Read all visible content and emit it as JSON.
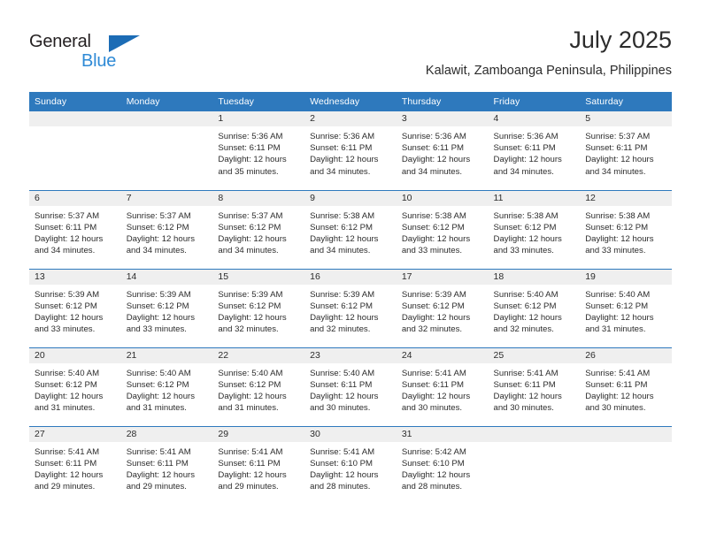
{
  "brand": {
    "name_part1": "General",
    "name_part2": "Blue",
    "triangle_color": "#1c6cb5",
    "blue_color": "#2e8ad6",
    "dark_color": "#231f20"
  },
  "header": {
    "title": "July 2025",
    "subtitle": "Kalawit, Zamboanga Peninsula, Philippines"
  },
  "theme": {
    "header_row_bg": "#2e79bd",
    "daynum_band_bg": "#efefef",
    "cell_bg": "#ffffff",
    "text_color": "#2c2c2c"
  },
  "weekdays": [
    "Sunday",
    "Monday",
    "Tuesday",
    "Wednesday",
    "Thursday",
    "Friday",
    "Saturday"
  ],
  "labels": {
    "sunrise_prefix": "Sunrise:",
    "sunset_prefix": "Sunset:",
    "daylight_prefix": "Daylight:"
  },
  "weeks": [
    [
      {
        "day": "",
        "empty": true
      },
      {
        "day": "",
        "empty": true
      },
      {
        "day": "1",
        "sunrise": "Sunrise: 5:36 AM",
        "sunset": "Sunset: 6:11 PM",
        "daylight_l1": "Daylight: 12 hours",
        "daylight_l2": "and 35 minutes."
      },
      {
        "day": "2",
        "sunrise": "Sunrise: 5:36 AM",
        "sunset": "Sunset: 6:11 PM",
        "daylight_l1": "Daylight: 12 hours",
        "daylight_l2": "and 34 minutes."
      },
      {
        "day": "3",
        "sunrise": "Sunrise: 5:36 AM",
        "sunset": "Sunset: 6:11 PM",
        "daylight_l1": "Daylight: 12 hours",
        "daylight_l2": "and 34 minutes."
      },
      {
        "day": "4",
        "sunrise": "Sunrise: 5:36 AM",
        "sunset": "Sunset: 6:11 PM",
        "daylight_l1": "Daylight: 12 hours",
        "daylight_l2": "and 34 minutes."
      },
      {
        "day": "5",
        "sunrise": "Sunrise: 5:37 AM",
        "sunset": "Sunset: 6:11 PM",
        "daylight_l1": "Daylight: 12 hours",
        "daylight_l2": "and 34 minutes."
      }
    ],
    [
      {
        "day": "6",
        "sunrise": "Sunrise: 5:37 AM",
        "sunset": "Sunset: 6:11 PM",
        "daylight_l1": "Daylight: 12 hours",
        "daylight_l2": "and 34 minutes."
      },
      {
        "day": "7",
        "sunrise": "Sunrise: 5:37 AM",
        "sunset": "Sunset: 6:12 PM",
        "daylight_l1": "Daylight: 12 hours",
        "daylight_l2": "and 34 minutes."
      },
      {
        "day": "8",
        "sunrise": "Sunrise: 5:37 AM",
        "sunset": "Sunset: 6:12 PM",
        "daylight_l1": "Daylight: 12 hours",
        "daylight_l2": "and 34 minutes."
      },
      {
        "day": "9",
        "sunrise": "Sunrise: 5:38 AM",
        "sunset": "Sunset: 6:12 PM",
        "daylight_l1": "Daylight: 12 hours",
        "daylight_l2": "and 34 minutes."
      },
      {
        "day": "10",
        "sunrise": "Sunrise: 5:38 AM",
        "sunset": "Sunset: 6:12 PM",
        "daylight_l1": "Daylight: 12 hours",
        "daylight_l2": "and 33 minutes."
      },
      {
        "day": "11",
        "sunrise": "Sunrise: 5:38 AM",
        "sunset": "Sunset: 6:12 PM",
        "daylight_l1": "Daylight: 12 hours",
        "daylight_l2": "and 33 minutes."
      },
      {
        "day": "12",
        "sunrise": "Sunrise: 5:38 AM",
        "sunset": "Sunset: 6:12 PM",
        "daylight_l1": "Daylight: 12 hours",
        "daylight_l2": "and 33 minutes."
      }
    ],
    [
      {
        "day": "13",
        "sunrise": "Sunrise: 5:39 AM",
        "sunset": "Sunset: 6:12 PM",
        "daylight_l1": "Daylight: 12 hours",
        "daylight_l2": "and 33 minutes."
      },
      {
        "day": "14",
        "sunrise": "Sunrise: 5:39 AM",
        "sunset": "Sunset: 6:12 PM",
        "daylight_l1": "Daylight: 12 hours",
        "daylight_l2": "and 33 minutes."
      },
      {
        "day": "15",
        "sunrise": "Sunrise: 5:39 AM",
        "sunset": "Sunset: 6:12 PM",
        "daylight_l1": "Daylight: 12 hours",
        "daylight_l2": "and 32 minutes."
      },
      {
        "day": "16",
        "sunrise": "Sunrise: 5:39 AM",
        "sunset": "Sunset: 6:12 PM",
        "daylight_l1": "Daylight: 12 hours",
        "daylight_l2": "and 32 minutes."
      },
      {
        "day": "17",
        "sunrise": "Sunrise: 5:39 AM",
        "sunset": "Sunset: 6:12 PM",
        "daylight_l1": "Daylight: 12 hours",
        "daylight_l2": "and 32 minutes."
      },
      {
        "day": "18",
        "sunrise": "Sunrise: 5:40 AM",
        "sunset": "Sunset: 6:12 PM",
        "daylight_l1": "Daylight: 12 hours",
        "daylight_l2": "and 32 minutes."
      },
      {
        "day": "19",
        "sunrise": "Sunrise: 5:40 AM",
        "sunset": "Sunset: 6:12 PM",
        "daylight_l1": "Daylight: 12 hours",
        "daylight_l2": "and 31 minutes."
      }
    ],
    [
      {
        "day": "20",
        "sunrise": "Sunrise: 5:40 AM",
        "sunset": "Sunset: 6:12 PM",
        "daylight_l1": "Daylight: 12 hours",
        "daylight_l2": "and 31 minutes."
      },
      {
        "day": "21",
        "sunrise": "Sunrise: 5:40 AM",
        "sunset": "Sunset: 6:12 PM",
        "daylight_l1": "Daylight: 12 hours",
        "daylight_l2": "and 31 minutes."
      },
      {
        "day": "22",
        "sunrise": "Sunrise: 5:40 AM",
        "sunset": "Sunset: 6:12 PM",
        "daylight_l1": "Daylight: 12 hours",
        "daylight_l2": "and 31 minutes."
      },
      {
        "day": "23",
        "sunrise": "Sunrise: 5:40 AM",
        "sunset": "Sunset: 6:11 PM",
        "daylight_l1": "Daylight: 12 hours",
        "daylight_l2": "and 30 minutes."
      },
      {
        "day": "24",
        "sunrise": "Sunrise: 5:41 AM",
        "sunset": "Sunset: 6:11 PM",
        "daylight_l1": "Daylight: 12 hours",
        "daylight_l2": "and 30 minutes."
      },
      {
        "day": "25",
        "sunrise": "Sunrise: 5:41 AM",
        "sunset": "Sunset: 6:11 PM",
        "daylight_l1": "Daylight: 12 hours",
        "daylight_l2": "and 30 minutes."
      },
      {
        "day": "26",
        "sunrise": "Sunrise: 5:41 AM",
        "sunset": "Sunset: 6:11 PM",
        "daylight_l1": "Daylight: 12 hours",
        "daylight_l2": "and 30 minutes."
      }
    ],
    [
      {
        "day": "27",
        "sunrise": "Sunrise: 5:41 AM",
        "sunset": "Sunset: 6:11 PM",
        "daylight_l1": "Daylight: 12 hours",
        "daylight_l2": "and 29 minutes."
      },
      {
        "day": "28",
        "sunrise": "Sunrise: 5:41 AM",
        "sunset": "Sunset: 6:11 PM",
        "daylight_l1": "Daylight: 12 hours",
        "daylight_l2": "and 29 minutes."
      },
      {
        "day": "29",
        "sunrise": "Sunrise: 5:41 AM",
        "sunset": "Sunset: 6:11 PM",
        "daylight_l1": "Daylight: 12 hours",
        "daylight_l2": "and 29 minutes."
      },
      {
        "day": "30",
        "sunrise": "Sunrise: 5:41 AM",
        "sunset": "Sunset: 6:10 PM",
        "daylight_l1": "Daylight: 12 hours",
        "daylight_l2": "and 28 minutes."
      },
      {
        "day": "31",
        "sunrise": "Sunrise: 5:42 AM",
        "sunset": "Sunset: 6:10 PM",
        "daylight_l1": "Daylight: 12 hours",
        "daylight_l2": "and 28 minutes."
      },
      {
        "day": "",
        "empty": true
      },
      {
        "day": "",
        "empty": true
      }
    ]
  ]
}
